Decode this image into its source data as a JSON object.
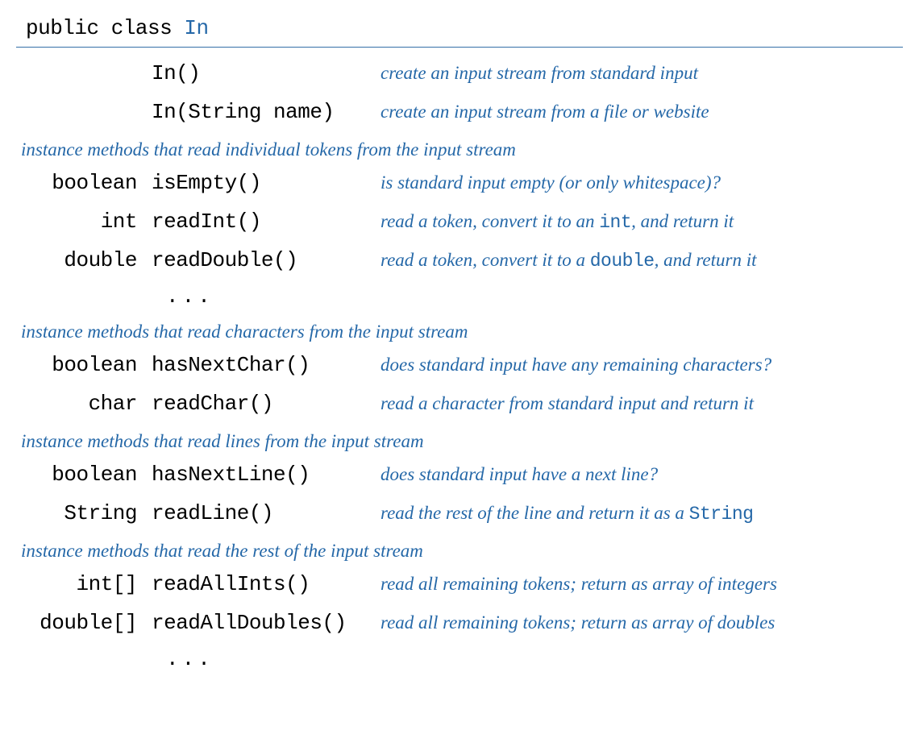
{
  "header": {
    "prefix": "public class ",
    "classname": "In"
  },
  "constructors": [
    {
      "ret": "",
      "sig": "In()",
      "desc": "create an input stream from standard input"
    },
    {
      "ret": "",
      "sig": "In(String name)",
      "desc": "create an input stream from a file or website"
    }
  ],
  "sections": [
    {
      "heading": "instance methods that read individual tokens from the input stream",
      "rows": [
        {
          "ret": "boolean",
          "sig": "isEmpty()",
          "desc_pre": "is standard input empty (or only whitespace)?",
          "mono": "",
          "desc_post": ""
        },
        {
          "ret": "int",
          "sig": "readInt()",
          "desc_pre": "read a token, convert it to an ",
          "mono": "int",
          "desc_post": ", and return it"
        },
        {
          "ret": "double",
          "sig": "readDouble()",
          "desc_pre": "read a token, convert it to a ",
          "mono": "double",
          "desc_post": ", and return it"
        }
      ],
      "ellipsis": "..."
    },
    {
      "heading": "instance methods that read characters from the input stream",
      "rows": [
        {
          "ret": "boolean",
          "sig": "hasNextChar()",
          "desc_pre": "does standard input have any remaining characters?",
          "mono": "",
          "desc_post": ""
        },
        {
          "ret": "char",
          "sig": "readChar()",
          "desc_pre": "read a character from standard input and return it",
          "mono": "",
          "desc_post": ""
        }
      ],
      "ellipsis": ""
    },
    {
      "heading": "instance methods that read lines from the input stream",
      "rows": [
        {
          "ret": "boolean",
          "sig": "hasNextLine()",
          "desc_pre": "does standard input have a next line?",
          "mono": "",
          "desc_post": ""
        },
        {
          "ret": "String",
          "sig": "readLine()",
          "desc_pre": "read the rest of the line and return it as a ",
          "mono": "String",
          "desc_post": ""
        }
      ],
      "ellipsis": ""
    },
    {
      "heading": "instance methods that read the rest of  the input stream",
      "rows": [
        {
          "ret": "int[]",
          "sig": "readAllInts()",
          "desc_pre": "read all remaining tokens; return as array of integers",
          "mono": "",
          "desc_post": ""
        },
        {
          "ret": "double[]",
          "sig": "readAllDoubles()",
          "desc_pre": "read all remaining tokens; return as array of doubles",
          "mono": "",
          "desc_post": ""
        }
      ],
      "ellipsis": "..."
    }
  ]
}
